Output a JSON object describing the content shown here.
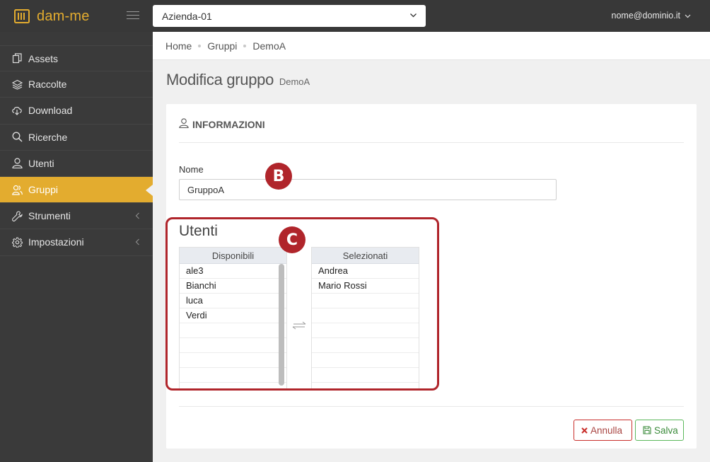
{
  "app": {
    "logo_text": "dam-me"
  },
  "header": {
    "organization": "Azienda-01",
    "user_email": "nome@dominio.it"
  },
  "sidebar": {
    "items": [
      {
        "label": "Assets",
        "icon": "copy-icon"
      },
      {
        "label": "Raccolte",
        "icon": "layers-icon"
      },
      {
        "label": "Download",
        "icon": "cloud-download-icon"
      },
      {
        "label": "Ricerche",
        "icon": "search-icon"
      },
      {
        "label": "Utenti",
        "icon": "user-icon"
      },
      {
        "label": "Gruppi",
        "icon": "users-icon",
        "active": true
      },
      {
        "label": "Strumenti",
        "icon": "wrench-icon",
        "has_submenu": true
      },
      {
        "label": "Impostazioni",
        "icon": "gear-icon",
        "has_submenu": true
      }
    ]
  },
  "breadcrumb": [
    "Home",
    "Gruppi",
    "DemoA"
  ],
  "page": {
    "title": "Modifica gruppo",
    "subtitle": "DemoA"
  },
  "form": {
    "section_header": "INFORMAZIONI",
    "name_label": "Nome",
    "name_value": "GruppoA",
    "users_title": "Utenti",
    "available_header": "Disponibili",
    "available": [
      "ale3",
      "Bianchi",
      "luca",
      "Verdi"
    ],
    "selected_header": "Selezionati",
    "selected": [
      "Andrea",
      "Mario Rossi"
    ]
  },
  "buttons": {
    "cancel": "Annulla",
    "save": "Salva"
  },
  "annotations": {
    "b": "B",
    "c": "C"
  },
  "colors": {
    "accent": "#e3ac2f",
    "topbar": "#383838",
    "sidebar": "#3a3a3a",
    "annotation": "#b0252b",
    "cancel": "#c9302c",
    "save": "#5cb85c"
  }
}
